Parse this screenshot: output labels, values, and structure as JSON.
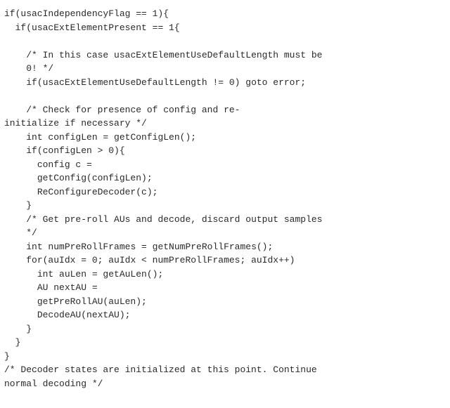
{
  "code": {
    "lines": [
      "if(usacIndependencyFlag == 1){",
      "  if(usacExtElementPresent == 1{",
      "",
      "    /* In this case usacExtElementUseDefaultLength must be",
      "    0! */",
      "    if(usacExtElementUseDefaultLength != 0) goto error;",
      "",
      "    /* Check for presence of config and re-",
      "initialize if necessary */",
      "    int configLen = getConfigLen();",
      "    if(configLen > 0){",
      "      config c =",
      "      getConfig(configLen);",
      "      ReConfigureDecoder(c);",
      "    }",
      "    /* Get pre-roll AUs and decode, discard output samples",
      "    */",
      "    int numPreRollFrames = getNumPreRollFrames();",
      "    for(auIdx = 0; auIdx < numPreRollFrames; auIdx++)",
      "      int auLen = getAuLen();",
      "      AU nextAU =",
      "      getPreRollAU(auLen);",
      "      DecodeAU(nextAU);",
      "    }",
      "  }",
      "}",
      "/* Decoder states are initialized at this point. Continue",
      "normal decoding */"
    ]
  }
}
